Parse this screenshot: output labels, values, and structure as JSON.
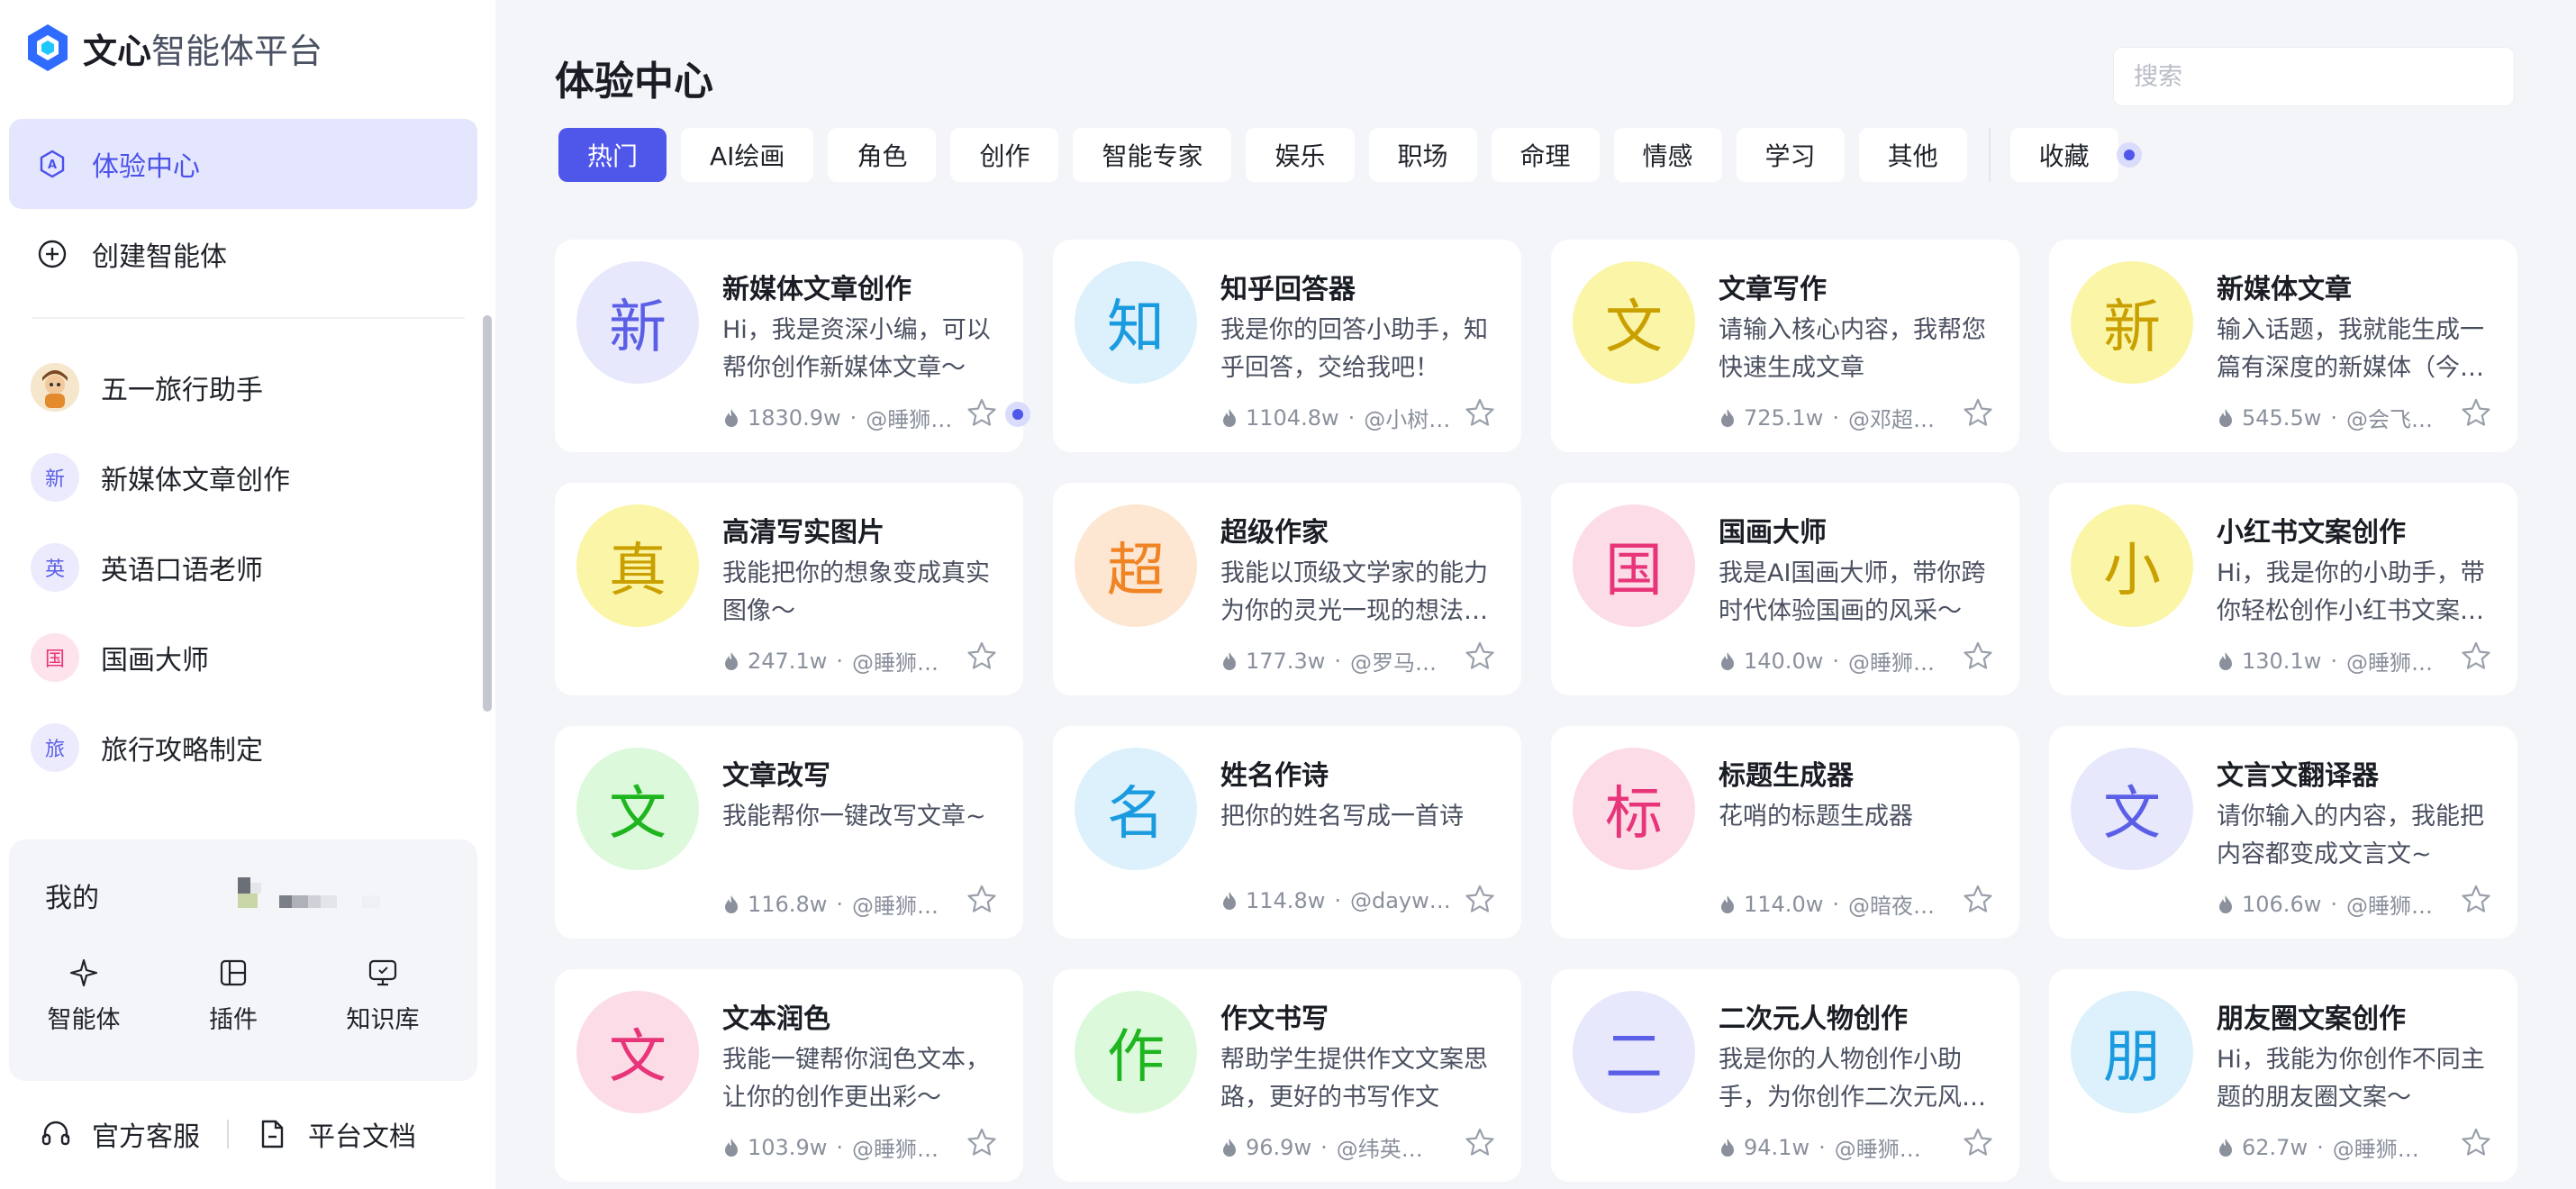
{
  "brand": {
    "name_bold": "文心",
    "name_light": "智能体平台"
  },
  "sidebar": {
    "nav": [
      {
        "label": "体验中心",
        "icon": "explore-icon",
        "active": true
      },
      {
        "label": "创建智能体",
        "icon": "plus-circle-icon",
        "active": false
      }
    ],
    "recent": [
      {
        "label": "五一旅行助手",
        "avatar": ""
      },
      {
        "label": "新媒体文章创作",
        "avatar": "新"
      },
      {
        "label": "英语口语老师",
        "avatar": "英"
      },
      {
        "label": "国画大师",
        "avatar": "国"
      },
      {
        "label": "旅行攻略制定",
        "avatar": "旅"
      }
    ],
    "mine": {
      "title": "我的",
      "tools": [
        {
          "label": "智能体",
          "icon": "sparkle-icon"
        },
        {
          "label": "插件",
          "icon": "plugin-icon"
        },
        {
          "label": "知识库",
          "icon": "knowledge-base-icon"
        }
      ]
    },
    "footer": {
      "support": "官方客服",
      "docs": "平台文档"
    }
  },
  "main": {
    "title": "体验中心",
    "search": {
      "placeholder": "搜索",
      "value": ""
    },
    "tabs": [
      "热门",
      "AI绘画",
      "角色",
      "创作",
      "智能专家",
      "娱乐",
      "职场",
      "命理",
      "情感",
      "学习",
      "其他"
    ],
    "active_tab": "热门",
    "favorites_tab": "收藏",
    "cards": [
      {
        "title": "新媒体文章创作",
        "desc": "Hi，我是资深小编，可以帮你创作新媒体文章～",
        "count": "1830.9w",
        "author": "@睡狮老师",
        "avatar": "新",
        "color": "#5b5fe6",
        "bg": "#e8e8fd"
      },
      {
        "title": "知乎回答器",
        "desc": "我是你的回答小助手，知乎回答，交给我吧！",
        "count": "1104.8w",
        "author": "@小树同学",
        "avatar": "知",
        "color": "#1a9be0",
        "bg": "#dcf1fb"
      },
      {
        "title": "文章写作",
        "desc": "请输入核心内容，我帮您快速生成文章",
        "count": "725.1w",
        "author": "@邓超老师",
        "avatar": "文",
        "color": "#c9a000",
        "bg": "#fbf5a8"
      },
      {
        "title": "新媒体文章",
        "desc": "输入话题，我就能生成一篇有深度的新媒体（今日头条）文章",
        "count": "545.5w",
        "author": "@会飞的鱼",
        "avatar": "新",
        "color": "#c9a000",
        "bg": "#fbf5a8"
      },
      {
        "title": "高清写实图片",
        "desc": "我能把你的想象变成真实图像～",
        "count": "247.1w",
        "author": "@睡狮老师",
        "avatar": "真",
        "color": "#c9a000",
        "bg": "#fbf5a8"
      },
      {
        "title": "超级作家",
        "desc": "我能以顶级文学家的能力为你的灵光一现的想法赋予生命",
        "count": "177.3w",
        "author": "@罗马假日",
        "avatar": "超",
        "color": "#f08322",
        "bg": "#fde6d2"
      },
      {
        "title": "国画大师",
        "desc": "我是AI国画大师，带你跨时代体验国画的风采～",
        "count": "140.0w",
        "author": "@睡狮老师",
        "avatar": "国",
        "color": "#e8357a",
        "bg": "#fcdde7"
      },
      {
        "title": "小红书文案创作",
        "desc": "Hi，我是你的小助手，带你轻松创作小红书文案，快来试试吧",
        "count": "130.1w",
        "author": "@睡狮老师",
        "avatar": "小",
        "color": "#c9a000",
        "bg": "#fbf5a8"
      },
      {
        "title": "文章改写",
        "desc": "我能帮你一键改写文章~",
        "count": "116.8w",
        "author": "@睡狮老师",
        "avatar": "文",
        "color": "#1fb51f",
        "bg": "#dcfadb"
      },
      {
        "title": "姓名作诗",
        "desc": "把你的姓名写成一首诗",
        "count": "114.8w",
        "author": "@daywinner",
        "avatar": "名",
        "color": "#1a9be0",
        "bg": "#dcf1fb"
      },
      {
        "title": "标题生成器",
        "desc": "花哨的标题生成器",
        "count": "114.0w",
        "author": "@暗夜丿流星",
        "avatar": "标",
        "color": "#e8357a",
        "bg": "#fcdde7"
      },
      {
        "title": "文言文翻译器",
        "desc": "请你输入的内容，我能把内容都变成文言文~",
        "count": "106.6w",
        "author": "@睡狮老师",
        "avatar": "文",
        "color": "#5b5fe6",
        "bg": "#e8e8fd"
      },
      {
        "title": "文本润色",
        "desc": "我能一键帮你润色文本，让你的创作更出彩～",
        "count": "103.9w",
        "author": "@睡狮老师",
        "avatar": "文",
        "color": "#e8357a",
        "bg": "#fcdde7"
      },
      {
        "title": "作文书写",
        "desc": "帮助学生提供作文文案思路，更好的书写作文",
        "count": "96.9w",
        "author": "@纬英科技",
        "avatar": "作",
        "color": "#1fb51f",
        "bg": "#dcfadb"
      },
      {
        "title": "二次元人物创作",
        "desc": "我是你的人物创作小助手，为你创作二次元风格的人物形象",
        "count": "94.1w",
        "author": "@睡狮老师",
        "avatar": "二",
        "color": "#5b5fe6",
        "bg": "#e8e8fd"
      },
      {
        "title": "朋友圈文案创作",
        "desc": "Hi，我能为你创作不同主题的朋友圈文案～",
        "count": "62.7w",
        "author": "@睡狮老师",
        "avatar": "朋",
        "color": "#1a9be0",
        "bg": "#dcf1fb"
      }
    ]
  }
}
